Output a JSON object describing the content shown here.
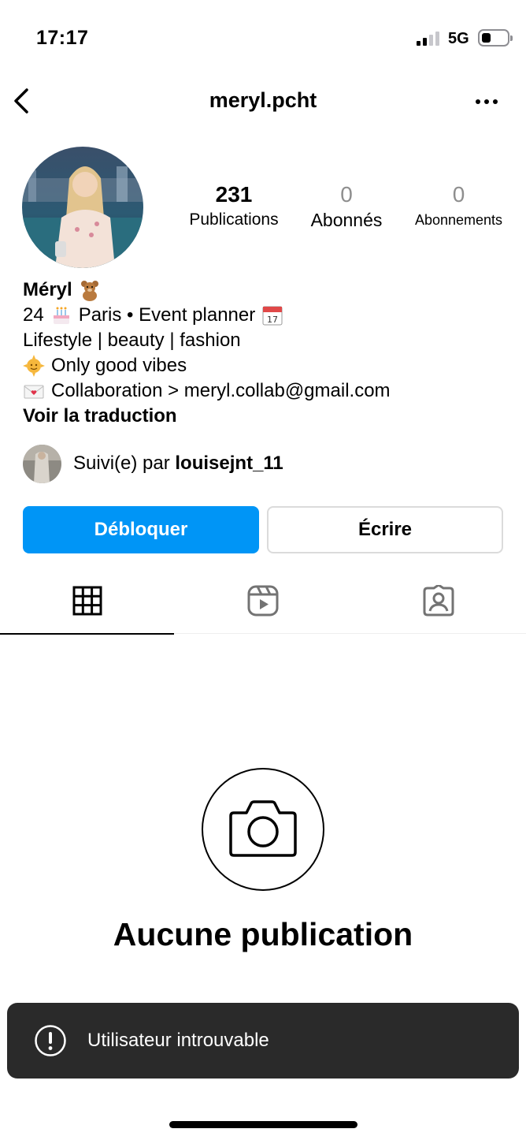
{
  "status_bar": {
    "time": "17:17",
    "network": "5G",
    "signal_bars": 2,
    "signal_bars_total": 4,
    "battery_level": 0.3
  },
  "header": {
    "username": "meryl.pcht",
    "back_icon": "chevron-left-icon",
    "more_icon": "ellipsis-icon"
  },
  "profile": {
    "stats": [
      {
        "value": "231",
        "label": "Publications"
      },
      {
        "value": "0",
        "label": "Abonnés"
      },
      {
        "value": "0",
        "label": "Abonnements"
      }
    ],
    "bio": {
      "name": "Méryl",
      "line1_prefix": "24",
      "line1_main": "Paris • Event planner",
      "line2": "Lifestyle | beauty | fashion",
      "line3": "Only good vibes",
      "line4": "Collaboration > meryl.collab@gmail.com",
      "translate": "Voir la traduction"
    },
    "followed_by": {
      "prefix": "Suivi(e) par",
      "user": "louisejnt_11"
    }
  },
  "actions": {
    "unblock_label": "Débloquer",
    "write_label": "Écrire"
  },
  "tabs": [
    {
      "icon": "grid-icon",
      "active": true
    },
    {
      "icon": "reels-icon",
      "active": false
    },
    {
      "icon": "tagged-icon",
      "active": false
    }
  ],
  "empty_state": {
    "icon": "camera-icon",
    "title": "Aucune publication"
  },
  "toast": {
    "icon": "alert-circle-icon",
    "message": "Utilisateur introuvable"
  },
  "colors": {
    "primary_button": "#0095f6",
    "toast_bg": "#2a2a2a",
    "muted_text": "#8e8e8e"
  }
}
